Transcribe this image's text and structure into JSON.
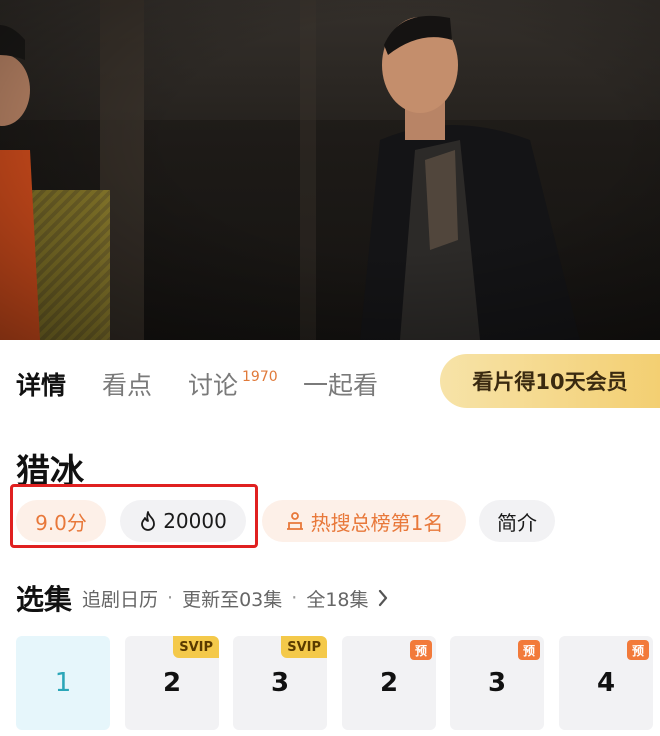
{
  "video": {
    "scene_icon": "video-frame"
  },
  "tabs": [
    {
      "label": "详情",
      "active": true
    },
    {
      "label": "看点"
    },
    {
      "label": "讨论",
      "count": "1970"
    },
    {
      "label": "一起看"
    }
  ],
  "promo_button": "看片得10天会员",
  "show": {
    "title": "猎冰",
    "score": "9.0分",
    "heat": "20000",
    "rank": "热搜总榜第1名",
    "intro": "简介"
  },
  "episodes": {
    "heading": "选集",
    "calendar": "追剧日历",
    "separator": "·",
    "updated": "更新至03集",
    "total": "全18集",
    "items": [
      {
        "label": "1",
        "badge": ""
      },
      {
        "label": "2",
        "badge": "SVIP"
      },
      {
        "label": "3",
        "badge": "SVIP"
      },
      {
        "label": "2",
        "badge": "预"
      },
      {
        "label": "3",
        "badge": "预"
      },
      {
        "label": "4",
        "badge": "预"
      }
    ]
  },
  "colors": {
    "accent_orange": "#e8783a",
    "active_episode": "#2aa6b8",
    "highlight_box": "#e02020",
    "svip_gold": "#f4c94a"
  }
}
